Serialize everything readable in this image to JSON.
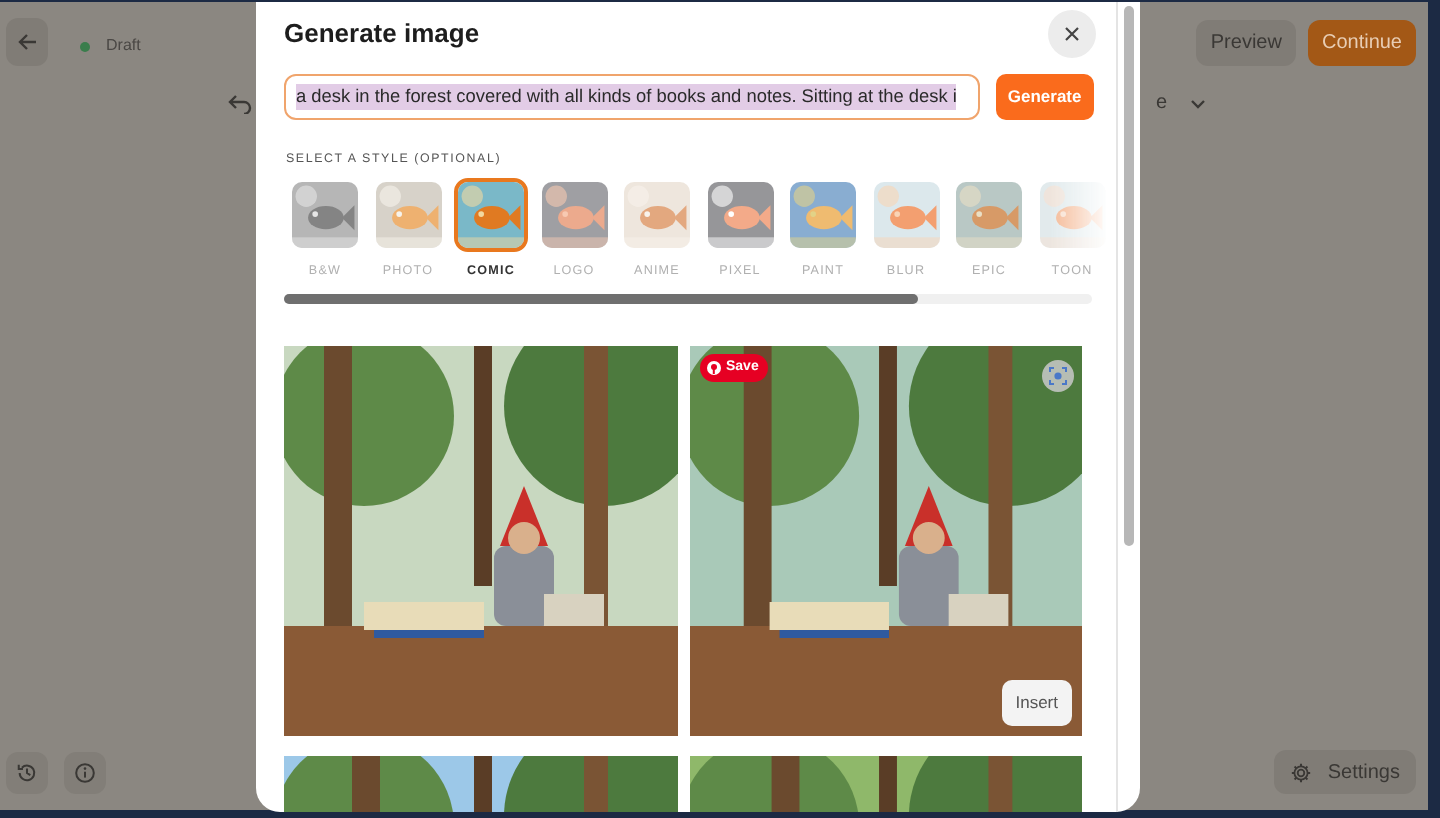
{
  "editor": {
    "status": "Draft",
    "preview": "Preview",
    "continue": "Continue",
    "toolbar_fragment": "e",
    "settings": "Settings"
  },
  "modal": {
    "title": "Generate image",
    "prompt_value": "a desk in the forest covered with all kinds of books and notes. Sitting at the desk i",
    "generate": "Generate",
    "style_heading": "SELECT A STYLE (OPTIONAL)",
    "styles": [
      {
        "label": "B&W",
        "selected": false
      },
      {
        "label": "PHOTO",
        "selected": false
      },
      {
        "label": "COMIC",
        "selected": true
      },
      {
        "label": "LOGO",
        "selected": false
      },
      {
        "label": "ANIME",
        "selected": false
      },
      {
        "label": "PIXEL",
        "selected": false
      },
      {
        "label": "PAINT",
        "selected": false
      },
      {
        "label": "BLUR",
        "selected": false
      },
      {
        "label": "EPIC",
        "selected": false
      },
      {
        "label": "TOON",
        "selected": false
      }
    ],
    "results": [
      {
        "kind": "picture"
      },
      {
        "kind": "picture",
        "save_badge": "Save",
        "insert": "Insert"
      },
      {
        "kind": "picture"
      },
      {
        "kind": "picture"
      }
    ]
  }
}
